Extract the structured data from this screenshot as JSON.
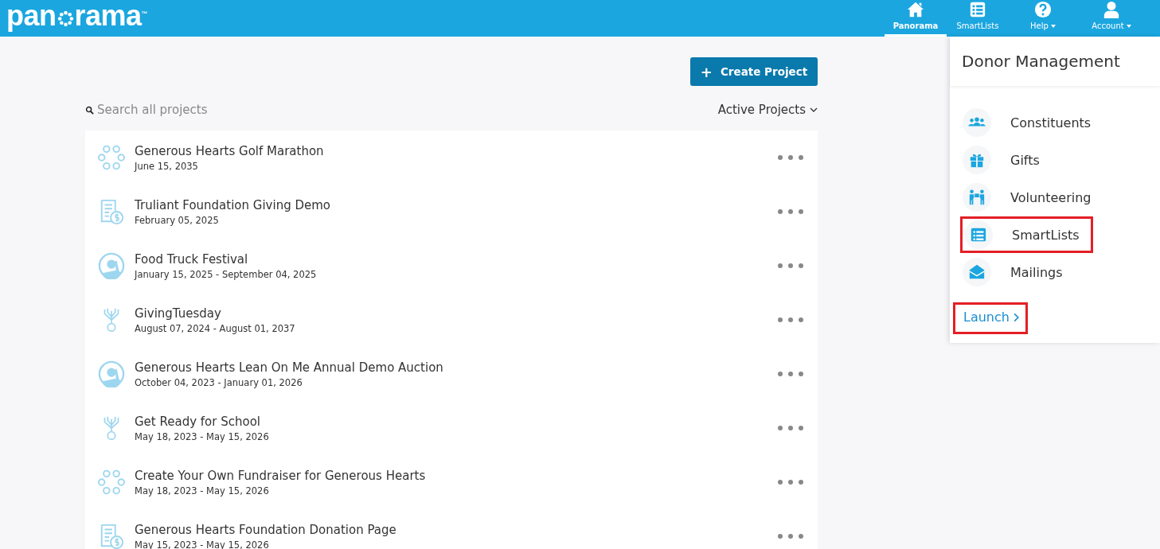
{
  "logo": {
    "before": "pan",
    "after": "rama",
    "mark": "™"
  },
  "nav": [
    {
      "label": "Panorama",
      "kind": "home",
      "selected": true,
      "dropdown": false
    },
    {
      "label": "SmartLists",
      "kind": "list",
      "selected": false,
      "dropdown": false
    },
    {
      "label": "Help",
      "kind": "help",
      "selected": false,
      "dropdown": true
    },
    {
      "label": "Account",
      "kind": "user",
      "selected": false,
      "dropdown": true
    }
  ],
  "create_button": {
    "icon": "+",
    "label": "Create Project"
  },
  "search": {
    "placeholder": "Search all projects"
  },
  "filter": {
    "label": "Active Projects"
  },
  "projects": [
    {
      "kind": "network",
      "name": "Generous Hearts Golf Marathon",
      "dates": "June 15, 2035"
    },
    {
      "kind": "document",
      "name": "Truliant Foundation Giving Demo",
      "dates": "February 05, 2025"
    },
    {
      "kind": "person",
      "name": "Food Truck Festival",
      "dates": "January 15, 2025 - September 04, 2025"
    },
    {
      "kind": "tree",
      "name": "GivingTuesday",
      "dates": "August 07, 2024 - August 01, 2037"
    },
    {
      "kind": "person",
      "name": "Generous Hearts Lean On Me Annual Demo Auction",
      "dates": "October 04, 2023 - January 01, 2026"
    },
    {
      "kind": "tree",
      "name": "Get Ready for School",
      "dates": "May 18, 2023 - May 15, 2026"
    },
    {
      "kind": "network",
      "name": "Create Your Own Fundraiser for Generous Hearts",
      "dates": "May 18, 2023 - May 15, 2026"
    },
    {
      "kind": "document",
      "name": "Generous Hearts Foundation Donation Page",
      "dates": "May 15, 2023 - May 15, 2026"
    }
  ],
  "panel": {
    "title": "Donor Management",
    "modules": [
      {
        "kind": "people",
        "label": "Constituents",
        "highlighted": false
      },
      {
        "kind": "gift",
        "label": "Gifts",
        "highlighted": false
      },
      {
        "kind": "volunteer",
        "label": "Volunteering",
        "highlighted": false
      },
      {
        "kind": "list",
        "label": "SmartLists",
        "highlighted": true
      },
      {
        "kind": "mail",
        "label": "Mailings",
        "highlighted": false
      }
    ],
    "launch": {
      "label": "Launch",
      "highlighted": true
    }
  }
}
